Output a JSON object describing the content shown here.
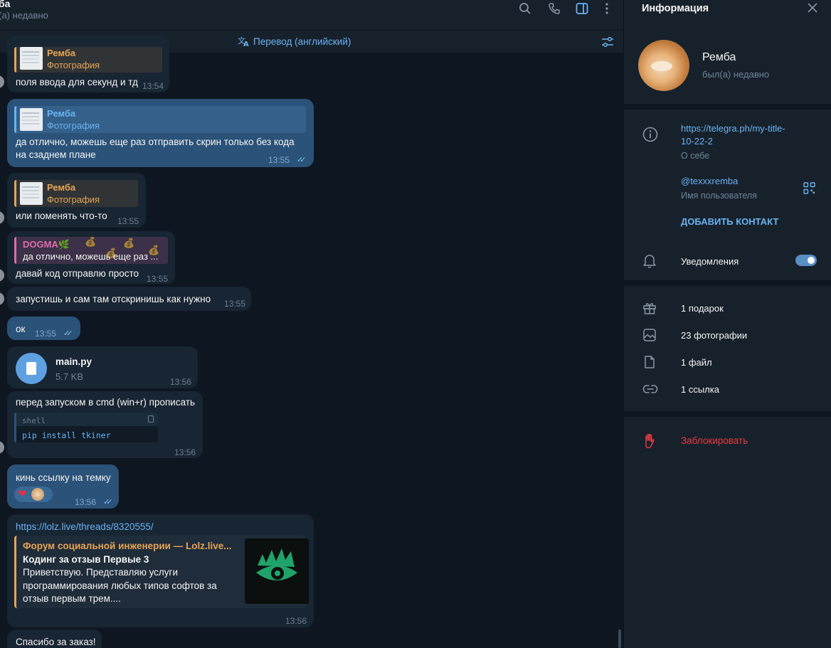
{
  "header": {
    "title": "ба",
    "status": "(а) недавно",
    "translate_label": "Перевод (английский)"
  },
  "messages": {
    "m1": {
      "reply_name": "Ремба",
      "reply_sub": "Фотография",
      "text": "поля ввода для секунд и тд",
      "time": "13:54"
    },
    "m2": {
      "reply_name": "Ремба",
      "reply_sub": "Фотография",
      "text1": "да отлично, можешь еще раз отправить скрин только без кода",
      "text2": "на сзаднем плане",
      "time": "13:55"
    },
    "m3": {
      "reply_name": "Ремба",
      "reply_sub": "Фотография",
      "text": "или поменять что-то",
      "time": "13:55"
    },
    "m4": {
      "reply_name": "DOGMA🌿",
      "reply_text": "да отлично, можешь еще раз ...",
      "text": "давай код отправлю просто",
      "time": "13:55"
    },
    "m5": {
      "text": "запустишь и сам там отскринишь как нужно",
      "time": "13:55"
    },
    "m6": {
      "text": "ок",
      "time": "13:55"
    },
    "m7": {
      "file_name": "main.py",
      "file_size": "5.7 KB",
      "time": "13:56"
    },
    "m8": {
      "text": "перед запуском в cmd (win+r) прописать",
      "code_lang": "shell",
      "code": "pip install tkiner",
      "time": "13:56"
    },
    "m9": {
      "text": "кинь ссылку на темку",
      "reaction": "❤",
      "time": "13:56"
    },
    "m10": {
      "url": "https://lolz.live/threads/8320555/",
      "site": "Форум социальной инженерии —  Lolz.live...",
      "title": "Кодинг за отзыв Первые 3",
      "desc": "Приветствую. Представляю услуги программирования любых типов софтов за отзыв первым трем....",
      "time": "13:56"
    },
    "m11": {
      "text": "Спасибо за заказ!"
    }
  },
  "info": {
    "title": "Информация",
    "name": "Ремба",
    "status": "был(а) недавно",
    "bio_link": "https://telegra.ph/my-title-10-22-2",
    "bio_label": "О себе",
    "username": "@texxxremba",
    "username_label": "Имя пользователя",
    "add_contact": "ДОБАВИТЬ КОНТАКТ",
    "notifications": "Уведомления",
    "notifications_on": true,
    "gifts": "1 подарок",
    "photos": "23 фотографии",
    "files": "1 файл",
    "links": "1 ссылка",
    "block": "Заблокировать"
  },
  "colors": {
    "accent": "#6ab3f3",
    "outgoing_bubble": "#2b5278",
    "incoming_bubble": "#182533",
    "reply_orange": "#e7a553",
    "danger": "#ec3942"
  }
}
